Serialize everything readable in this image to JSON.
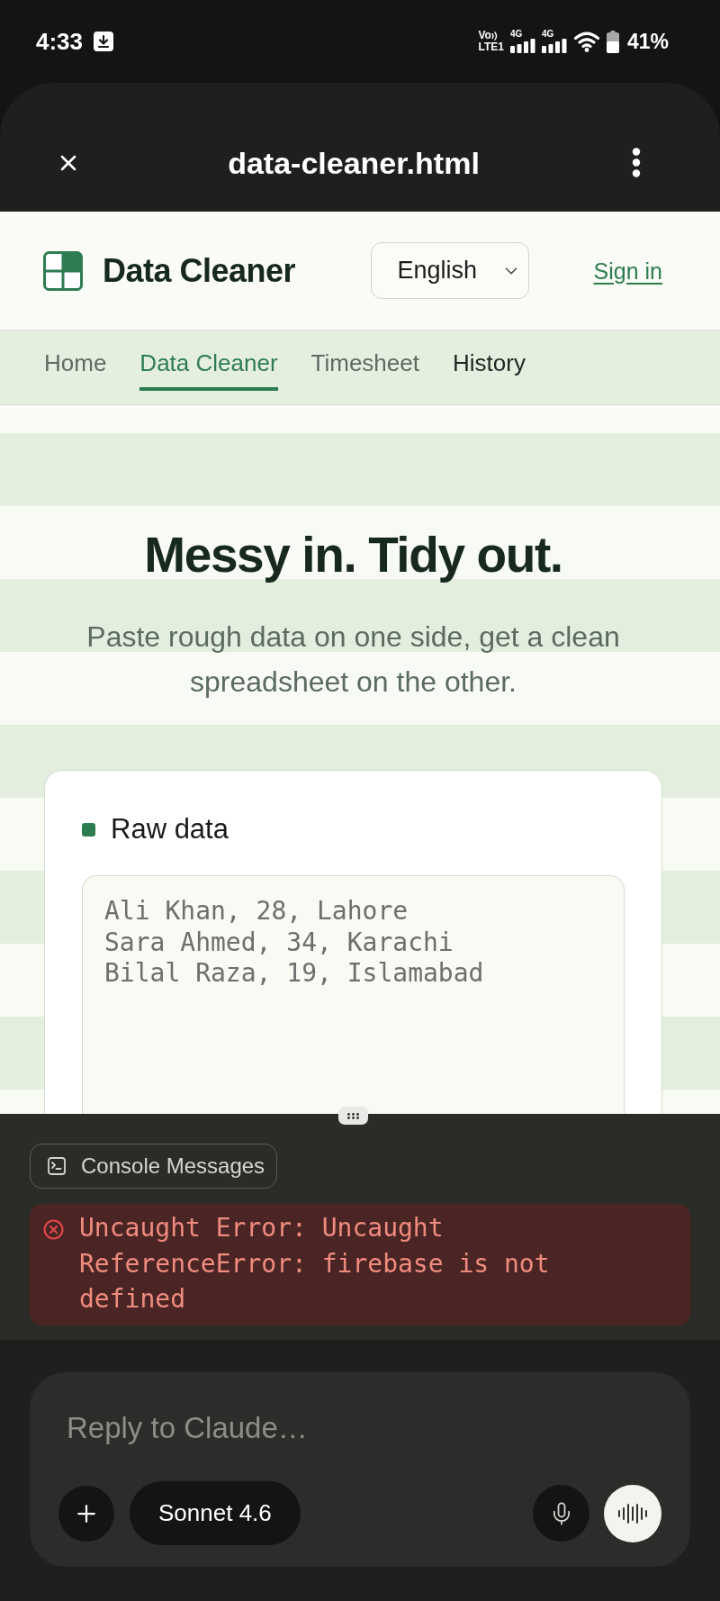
{
  "status_bar": {
    "time": "4:33",
    "volte": {
      "top": "Vo",
      "bottom": "LTE1"
    },
    "networks": [
      {
        "label": "4G"
      },
      {
        "label": "4G"
      }
    ],
    "battery": "41%"
  },
  "browser_bar": {
    "title": "data-cleaner.html"
  },
  "site_header": {
    "brand": "Data Cleaner",
    "language": "English",
    "sign_in": "Sign in"
  },
  "nav": [
    {
      "label": "Home",
      "selected": false,
      "hovered": false
    },
    {
      "label": "Data Cleaner",
      "selected": true,
      "hovered": false
    },
    {
      "label": "Timesheet",
      "selected": false,
      "hovered": false
    },
    {
      "label": "History",
      "selected": false,
      "hovered": true
    }
  ],
  "hero": {
    "title": "Messy in. Tidy out.",
    "subtitle": "Paste rough data on one side, get a clean spreadsheet on the other."
  },
  "raw_data_card": {
    "title": "Raw data",
    "placeholder": "Ali Khan, 28, Lahore\nSara Ahmed, 34, Karachi\nBilal Raza, 19, Islamabad"
  },
  "console": {
    "button": "Console Messages",
    "errors": [
      {
        "message": "Uncaught Error: Uncaught ReferenceError: firebase is not defined"
      }
    ]
  },
  "composer": {
    "placeholder": "Reply to Claude…",
    "model": "Sonnet 4.6"
  }
}
